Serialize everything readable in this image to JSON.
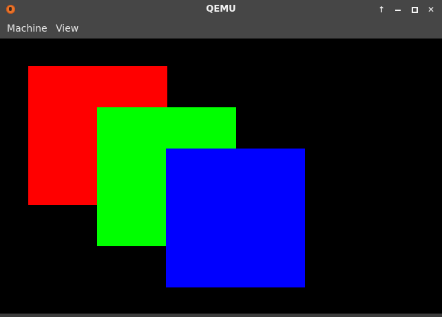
{
  "window": {
    "title": "QEMU",
    "controls": {
      "up_icon": "arrow-up-icon",
      "minimize_icon": "minimize-icon",
      "maximize_icon": "maximize-icon",
      "close_icon": "close-icon"
    }
  },
  "menubar": {
    "items": [
      {
        "label": "Machine"
      },
      {
        "label": "View"
      }
    ]
  },
  "display": {
    "background": "#000000",
    "squares": [
      {
        "name": "red-square",
        "color": "#ff0000"
      },
      {
        "name": "green-square",
        "color": "#00ff00"
      },
      {
        "name": "blue-square",
        "color": "#0000ff"
      }
    ]
  },
  "colors": {
    "titlebar": "#464646",
    "app_icon": "#e8732a"
  }
}
